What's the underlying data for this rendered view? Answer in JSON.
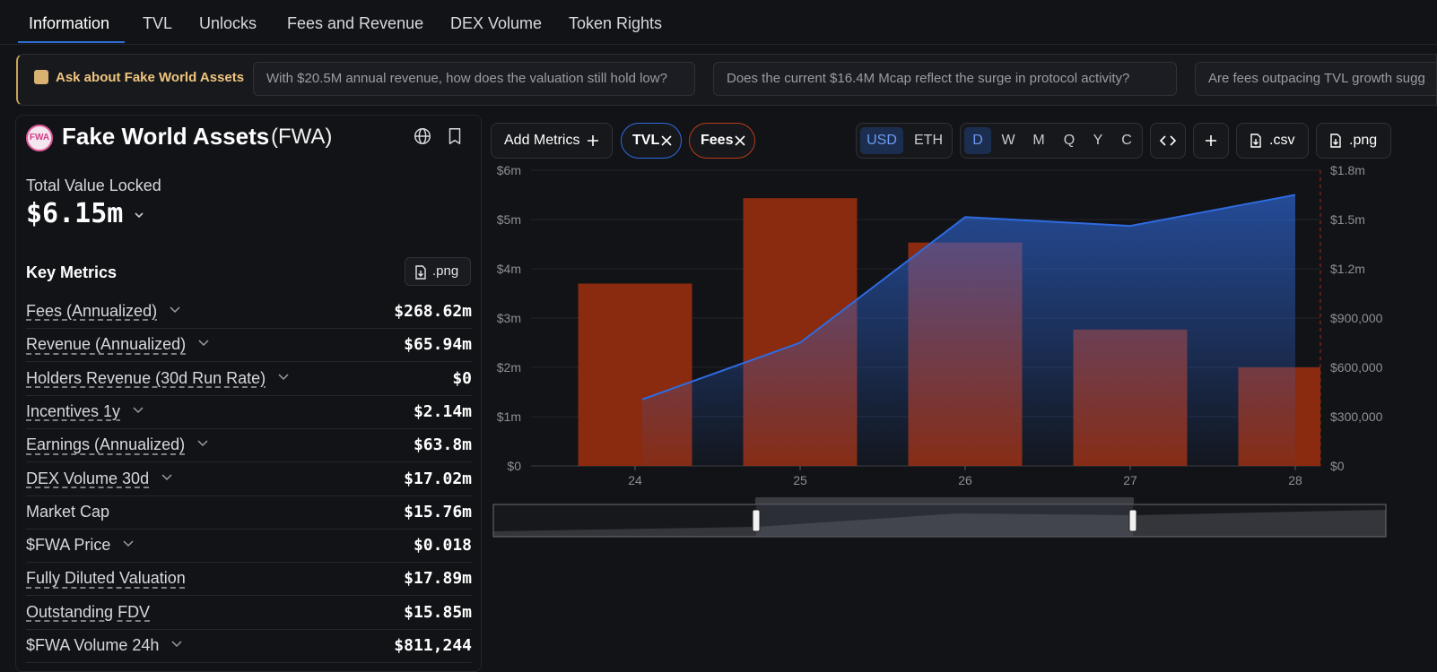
{
  "tabs": [
    {
      "label": "Information",
      "active": true
    },
    {
      "label": "TVL"
    },
    {
      "label": "Unlocks"
    },
    {
      "label": "Fees and Revenue"
    },
    {
      "label": "DEX Volume"
    },
    {
      "label": "Token Rights"
    }
  ],
  "ask": {
    "label": "Ask about Fake World Assets",
    "suggestions": [
      "With $20.5M annual revenue, how does the valuation still hold low?",
      "Does the current $16.4M Mcap reflect the surge in protocol activity?",
      "Are fees outpacing TVL growth sugg"
    ]
  },
  "protocol": {
    "logo_text": "FWA",
    "name": "Fake World Assets",
    "ticker": "(FWA)",
    "tvl_label": "Total Value Locked",
    "tvl_value": "$6.15m"
  },
  "key_metrics": {
    "title": "Key Metrics",
    "png_label": ".png",
    "rows": [
      {
        "label": "Fees (Annualized)",
        "value": "$268.62m",
        "dashed": true,
        "chevron": true
      },
      {
        "label": "Revenue (Annualized)",
        "value": "$65.94m",
        "dashed": true,
        "chevron": true
      },
      {
        "label": "Holders Revenue (30d Run Rate)",
        "value": "$0",
        "dashed": true,
        "chevron": true
      },
      {
        "label": "Incentives 1y",
        "value": "$2.14m",
        "dashed": true,
        "chevron": true
      },
      {
        "label": "Earnings (Annualized)",
        "value": "$63.8m",
        "dashed": true,
        "chevron": true
      },
      {
        "label": "DEX Volume 30d",
        "value": "$17.02m",
        "dashed": true,
        "chevron": true
      },
      {
        "label": "Market Cap",
        "value": "$15.76m",
        "dashed": false,
        "chevron": false
      },
      {
        "label": "$FWA Price",
        "value": "$0.018",
        "dashed": false,
        "chevron": true
      },
      {
        "label": "Fully Diluted Valuation",
        "value": "$17.89m",
        "dashed": true,
        "chevron": false
      },
      {
        "label": "Outstanding FDV",
        "value": "$15.85m",
        "dashed": true,
        "chevron": false
      },
      {
        "label": "$FWA Volume 24h",
        "value": "$811,244",
        "dashed": false,
        "chevron": true
      }
    ]
  },
  "toolbar": {
    "add_metrics": "Add Metrics",
    "pill_tvl": "TVL",
    "pill_fees": "Fees",
    "currency": [
      "USD",
      "ETH"
    ],
    "currency_selected": "USD",
    "periods": [
      "D",
      "W",
      "M",
      "Q",
      "Y",
      "C"
    ],
    "period_selected": "D",
    "csv_label": ".csv",
    "png_label": ".png"
  },
  "colors": {
    "tvl_line": "#2f6be0",
    "fees_bar": "#8a2a0e",
    "accent": "#2f6fd6",
    "ask_accent": "#f0c57d"
  },
  "chart_data": {
    "type": "bar",
    "categories": [
      "24",
      "25",
      "26",
      "27",
      "28"
    ],
    "series": [
      {
        "name": "Fees",
        "type": "bar",
        "axis": "right",
        "values": [
          1110000,
          1630000,
          1360000,
          830000,
          600000
        ],
        "color": "#8a2a0e"
      },
      {
        "name": "TVL",
        "type": "area",
        "axis": "left",
        "values": [
          1350000,
          2500000,
          5050000,
          4870000,
          5500000
        ],
        "color": "#2f6be0"
      }
    ],
    "y_left": {
      "ticks": [
        "$0",
        "$1m",
        "$2m",
        "$3m",
        "$4m",
        "$5m",
        "$6m"
      ],
      "range": [
        0,
        6000000
      ]
    },
    "y_right": {
      "ticks": [
        "$0",
        "$300,000",
        "$600,000",
        "$900,000",
        "$1.2m",
        "$1.5m",
        "$1.8m"
      ],
      "range": [
        0,
        1800000
      ]
    },
    "grid": true
  }
}
